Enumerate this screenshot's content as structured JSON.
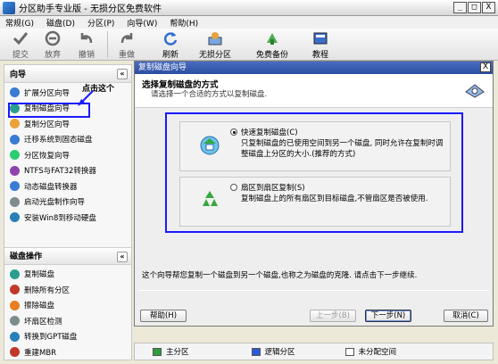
{
  "window": {
    "title": "分区助手专业版 - 无损分区免费软件",
    "controls": [
      "_",
      "□",
      "X"
    ]
  },
  "menu": [
    "常规(G)",
    "磁盘(D)",
    "分区(P)",
    "向导(W)",
    "帮助(H)"
  ],
  "toolbar": [
    {
      "label": "提交",
      "icon": "check-icon",
      "enabled": false
    },
    {
      "label": "放弃",
      "icon": "discard-icon",
      "enabled": false
    },
    {
      "label": "撤销",
      "icon": "undo-icon",
      "enabled": false
    },
    {
      "label": "重做",
      "icon": "redo-icon",
      "enabled": false
    },
    {
      "label": "刷新",
      "icon": "refresh-icon",
      "enabled": true
    },
    {
      "label": "无损分区",
      "icon": "partition-icon",
      "enabled": true
    },
    {
      "label": "免费备份",
      "icon": "backup-icon",
      "enabled": true
    },
    {
      "label": "教程",
      "icon": "tutorial-icon",
      "enabled": true
    }
  ],
  "sidebar": {
    "wizard_title": "向导",
    "wizard_items": [
      {
        "label": "扩展分区向导",
        "color": "#3a7bd5"
      },
      {
        "label": "复制磁盘向导",
        "color": "#2a9d8f"
      },
      {
        "label": "复制分区向导",
        "color": "#e9a23b"
      },
      {
        "label": "迁移系统到固态磁盘",
        "color": "#3a7bd5"
      },
      {
        "label": "分区恢复向导",
        "color": "#2ecc71"
      },
      {
        "label": "NTFS与FAT32转换器",
        "color": "#8e44ad"
      },
      {
        "label": "动态磁盘转换器",
        "color": "#3a7bd5"
      },
      {
        "label": "启动光盘制作向导",
        "color": "#7f8c8d"
      },
      {
        "label": "安装Win8到移动硬盘",
        "color": "#2980b9"
      }
    ],
    "disk_ops_title": "磁盘操作",
    "disk_ops_items": [
      {
        "label": "复制磁盘",
        "color": "#2a9d8f"
      },
      {
        "label": "删除所有分区",
        "color": "#c0392b"
      },
      {
        "label": "擦除磁盘",
        "color": "#e67e22"
      },
      {
        "label": "坏扇区检测",
        "color": "#7f8c8d"
      },
      {
        "label": "转换到GPT磁盘",
        "color": "#2980b9"
      },
      {
        "label": "重建MBR",
        "color": "#c0392b"
      }
    ],
    "collapse_symbol": "«",
    "annotation": "点击这个"
  },
  "dialog": {
    "title": "复制磁盘向导",
    "close": "X",
    "heading": "选择复制磁盘的方式",
    "subheading": "请选择一个合适的方式以复制磁盘.",
    "options": [
      {
        "title": "快速复制磁盘(C)",
        "desc": "只复制磁盘的已使用空间到另一个磁盘, 同时允许在复制时调整磁盘上分区的大小.(推荐的方式)",
        "selected": true
      },
      {
        "title": "扇区到扇区复制(S)",
        "desc": "复制磁盘上的所有扇区到目标磁盘,不管扇区是否被使用.",
        "selected": false
      }
    ],
    "info": "这个向导帮您复制一个磁盘到另一个磁盘,也称之为磁盘的克隆. 请点击下一步继续.",
    "buttons": {
      "help": "帮助(H)",
      "back": "上一步(B)",
      "next": "下一步(N)",
      "cancel": "取消(C)"
    }
  },
  "legend": [
    {
      "label": "主分区",
      "color": "#2e9e3a"
    },
    {
      "label": "逻辑分区",
      "color": "#2a5bd7"
    },
    {
      "label": "未分配空间",
      "color": "#ffffff"
    }
  ]
}
